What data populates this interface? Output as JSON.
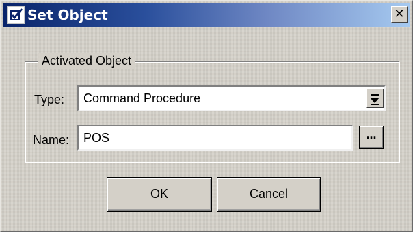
{
  "window": {
    "title": "Set Object",
    "close_glyph": "✕"
  },
  "group": {
    "legend": "Activated Object"
  },
  "type_row": {
    "label": "Type:",
    "value": "Command Procedure",
    "dropdown_icon": "dropdown-arrow-icon"
  },
  "name_row": {
    "label": "Name:",
    "value": "POS",
    "browse_label": "..."
  },
  "buttons": {
    "ok": "OK",
    "cancel": "Cancel"
  },
  "colors": {
    "title_start": "#0a246a",
    "title_end": "#a6caf0",
    "face": "#d4d0c8"
  }
}
